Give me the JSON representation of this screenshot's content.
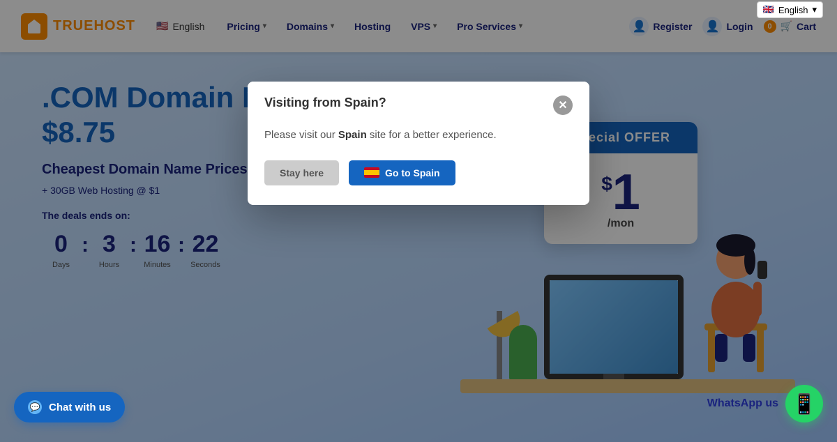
{
  "topBar": {
    "languageLabel": "English",
    "flagAlt": "English flag"
  },
  "header": {
    "logoText": "TRUEHOST",
    "langLabel": "English",
    "nav": {
      "pricing": "Pricing",
      "domains": "Domains",
      "hosting": "Hosting",
      "vps": "VPS",
      "pro": "Pro Services"
    },
    "register": "Register",
    "login": "Login",
    "cart": "Cart",
    "cartCount": "0"
  },
  "hero": {
    "title1": ".COM Domain Name @",
    "title2": "$8.75",
    "subtitle": "Cheapest Domain Name Prices on Earth",
    "offer": "+ 30GB Web Hosting @ $1",
    "dealText": "The deals ends on:",
    "countdown": {
      "days": "0",
      "hours": "3",
      "minutes": "16",
      "seconds": "22",
      "daysLabel": "Days",
      "hoursLabel": "Hours",
      "minutesLabel": "Minutes",
      "secondsLabel": "Seconds"
    },
    "specialOffer": {
      "header": "Special OFFER",
      "priceDollar": "$",
      "priceNumber": "1",
      "priceMon": "/mon"
    }
  },
  "chat": {
    "label": "Chat with us"
  },
  "whatsapp": {
    "label": "WhatsApp us"
  },
  "modal": {
    "title": "Visiting from Spain?",
    "bodyText1": "Please visit our ",
    "bodyBold": "Spain",
    "bodyText2": " site for a better experience.",
    "stayBtn": "Stay here",
    "goBtn": "Go to Spain"
  }
}
